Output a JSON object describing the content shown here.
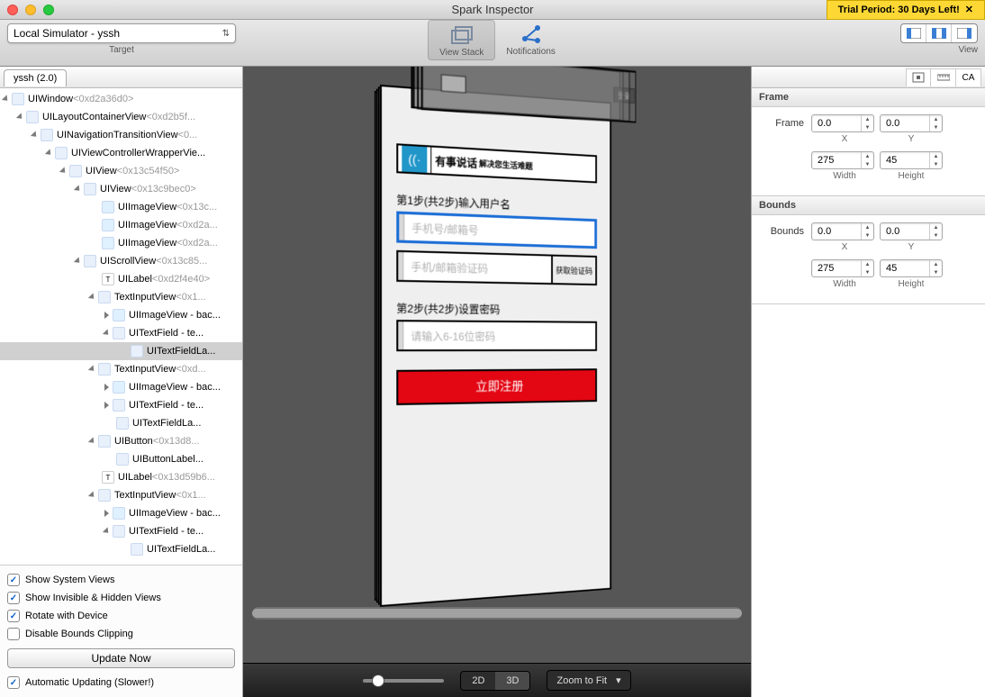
{
  "window": {
    "title": "Spark Inspector",
    "trial": "Trial Period: 30 Days Left!"
  },
  "toolbar": {
    "target_value": "Local Simulator - yssh",
    "target_label": "Target",
    "viewstack_label": "View Stack",
    "notifications_label": "Notifications",
    "view_label": "View"
  },
  "left": {
    "tab": "yssh (2.0)",
    "options": {
      "show_system": "Show System Views",
      "show_invisible": "Show Invisible & Hidden Views",
      "rotate": "Rotate with Device",
      "disable_bounds": "Disable Bounds Clipping",
      "update_now": "Update Now",
      "auto_update": "Automatic Updating (Slower!)"
    }
  },
  "tree": [
    {
      "d": 0,
      "open": true,
      "icon": "v",
      "name": "UIWindow",
      "addr": "<0xd2a36d0>"
    },
    {
      "d": 1,
      "open": true,
      "icon": "v",
      "name": "UILayoutContainerView",
      "addr": "<0xd2b5f..."
    },
    {
      "d": 2,
      "open": true,
      "icon": "v",
      "name": "UINavigationTransitionView",
      "addr": "<0..."
    },
    {
      "d": 3,
      "open": true,
      "icon": "v",
      "name": "UIViewControllerWrapperVie...",
      "addr": ""
    },
    {
      "d": 4,
      "open": true,
      "icon": "v",
      "name": "UIView",
      "addr": "<0x13c54f50>"
    },
    {
      "d": 5,
      "open": true,
      "icon": "v",
      "name": "UIView",
      "addr": "<0x13c9bec0>"
    },
    {
      "d": 6,
      "open": false,
      "icon": "img",
      "leaf": true,
      "name": "UIImageView",
      "addr": "<0x13c..."
    },
    {
      "d": 6,
      "open": false,
      "icon": "img",
      "leaf": true,
      "name": "UIImageView",
      "addr": "<0xd2a..."
    },
    {
      "d": 6,
      "open": false,
      "icon": "img",
      "leaf": true,
      "name": "UIImageView",
      "addr": "<0xd2a..."
    },
    {
      "d": 5,
      "open": true,
      "icon": "v",
      "name": "UIScrollView",
      "addr": "<0x13c85..."
    },
    {
      "d": 6,
      "open": false,
      "icon": "txt",
      "leaf": true,
      "name": "UILabel",
      "addr": "<0xd2f4e40>"
    },
    {
      "d": 6,
      "open": true,
      "icon": "v",
      "name": "TextInputView",
      "addr": "<0x1..."
    },
    {
      "d": 7,
      "open": false,
      "icon": "img",
      "name": "UIImageView - bac...",
      "addr": ""
    },
    {
      "d": 7,
      "open": true,
      "icon": "v",
      "name": "UITextField - te...",
      "addr": ""
    },
    {
      "d": 8,
      "open": false,
      "icon": "v",
      "leaf": true,
      "sel": true,
      "name": "UITextFieldLa...",
      "addr": ""
    },
    {
      "d": 6,
      "open": true,
      "icon": "v",
      "name": "TextInputView",
      "addr": "<0xd..."
    },
    {
      "d": 7,
      "open": false,
      "icon": "img",
      "name": "UIImageView - bac...",
      "addr": ""
    },
    {
      "d": 7,
      "open": false,
      "icon": "v",
      "name": "UITextField - te...",
      "addr": ""
    },
    {
      "d": 7,
      "open": false,
      "icon": "v",
      "leaf": true,
      "name": "UITextFieldLa...",
      "addr": ""
    },
    {
      "d": 6,
      "open": true,
      "icon": "v",
      "name": "UIButton",
      "addr": "<0x13d8..."
    },
    {
      "d": 7,
      "open": false,
      "icon": "v",
      "leaf": true,
      "name": "UIButtonLabel...",
      "addr": ""
    },
    {
      "d": 6,
      "open": false,
      "icon": "txt",
      "leaf": true,
      "name": "UILabel",
      "addr": "<0x13d59b6..."
    },
    {
      "d": 6,
      "open": true,
      "icon": "v",
      "name": "TextInputView",
      "addr": "<0x1..."
    },
    {
      "d": 7,
      "open": false,
      "icon": "img",
      "name": "UIImageView - bac...",
      "addr": ""
    },
    {
      "d": 7,
      "open": true,
      "icon": "v",
      "name": "UITextField - te...",
      "addr": ""
    },
    {
      "d": 8,
      "open": false,
      "icon": "v",
      "leaf": true,
      "name": "UITextFieldLa...",
      "addr": ""
    }
  ],
  "phone": {
    "nav_right": "登录",
    "logo_main": "有事说话",
    "logo_sub": "解决您生活难题",
    "step1": "第1步(共2步)输入用户名",
    "f1_ph": "手机号/邮箱号",
    "f2_ph": "手机/邮箱验证码",
    "f2_btn": "获取验证码",
    "step2": "第2步(共2步)设置密码",
    "f3_ph": "请输入6-16位密码",
    "register": "立即注册"
  },
  "bottom": {
    "mode_2d": "2D",
    "mode_3d": "3D",
    "zoom": "Zoom to Fit"
  },
  "right": {
    "tab_ca": "CA",
    "frame_h": "Frame",
    "frame_label": "Frame",
    "bounds_h": "Bounds",
    "bounds_label": "Bounds",
    "x": "X",
    "y": "Y",
    "width": "Width",
    "height": "Height",
    "frame": {
      "x": "0.0",
      "y": "0.0",
      "w": "275",
      "h": "45"
    },
    "bounds": {
      "x": "0.0",
      "y": "0.0",
      "w": "275",
      "h": "45"
    }
  }
}
